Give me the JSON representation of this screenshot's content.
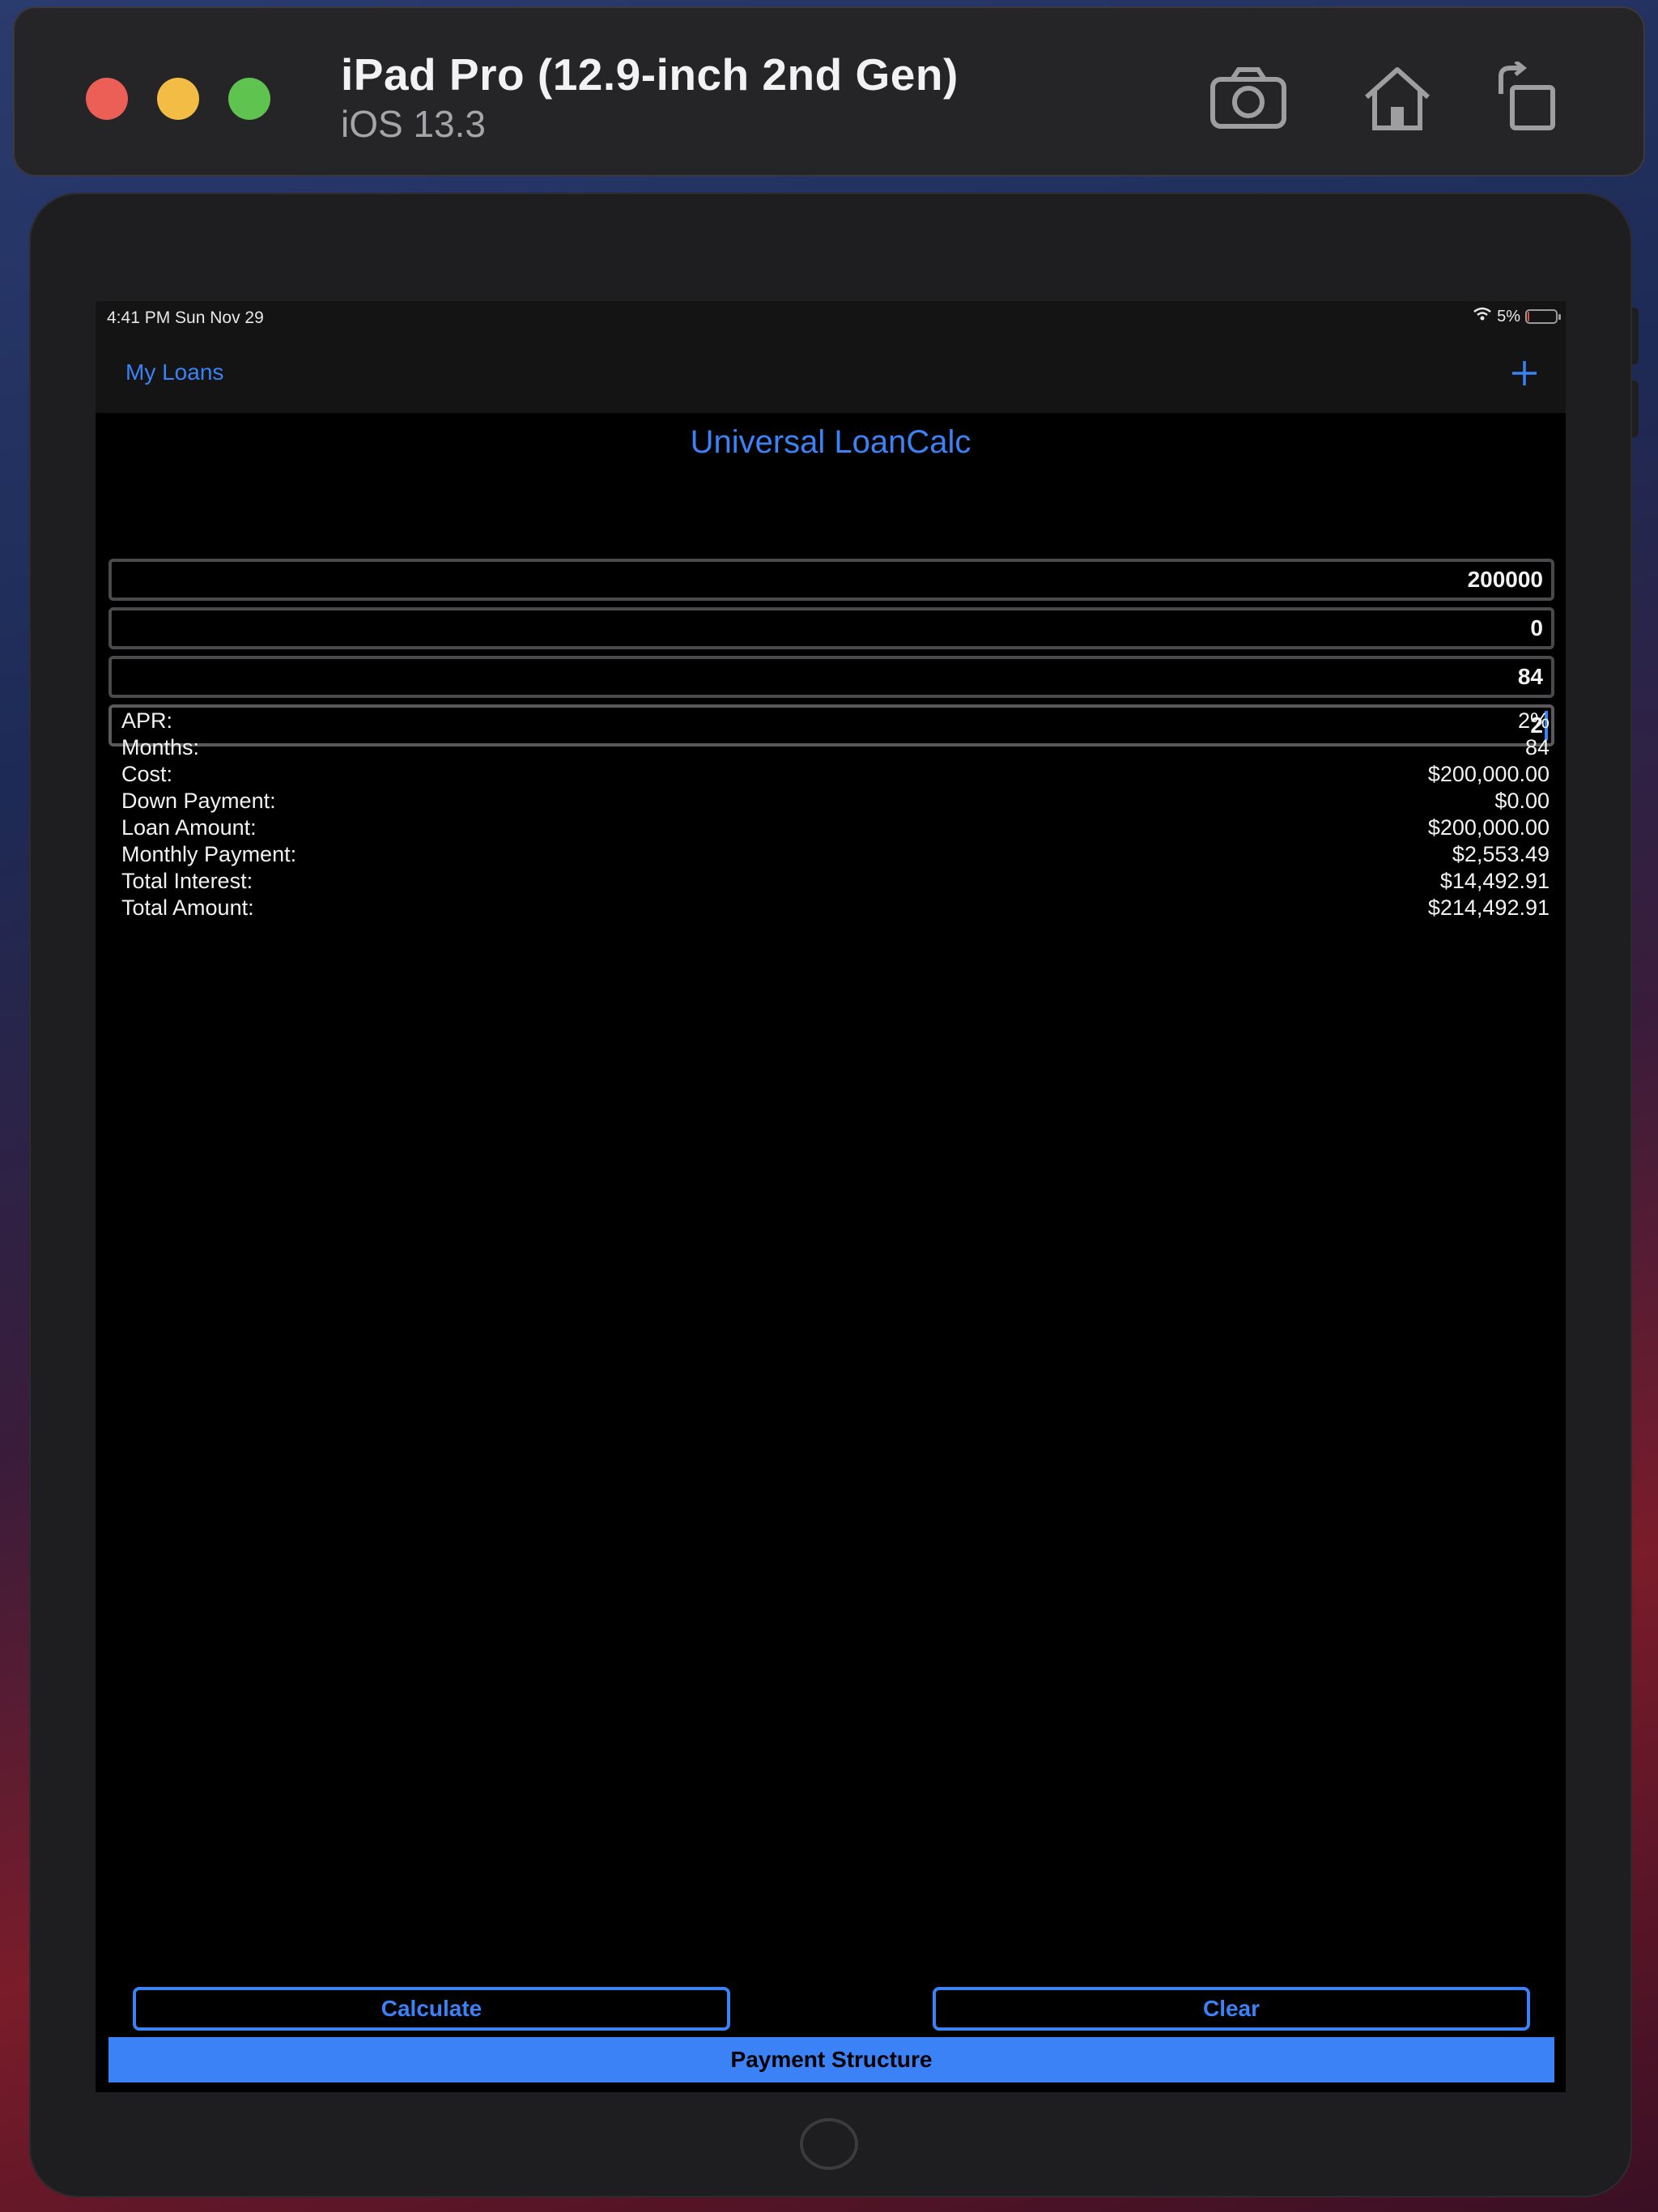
{
  "simulator": {
    "device_name": "iPad Pro (12.9-inch 2nd Gen)",
    "os_version": "iOS 13.3",
    "toolbar_icons": [
      "camera-icon",
      "home-icon",
      "rotate-icon"
    ]
  },
  "status_bar": {
    "time": "4:41 PM   Sun Nov 29",
    "battery": "5%",
    "battery_level": 0.05
  },
  "nav": {
    "back_label": "My Loans",
    "add_icon": "plus-icon"
  },
  "app_title": "Universal LoanCalc",
  "fields": {
    "cost": "200000",
    "down_payment": "0",
    "months": "84",
    "apr": "2"
  },
  "results": [
    {
      "label": "APR:",
      "value": "2%"
    },
    {
      "label": "Months:",
      "value": "84"
    },
    {
      "label": "Cost:",
      "value": "$200,000.00"
    },
    {
      "label": "Down Payment:",
      "value": "$0.00"
    },
    {
      "label": "Loan Amount:",
      "value": "$200,000.00"
    },
    {
      "label": "Monthly Payment:",
      "value": "$2,553.49"
    },
    {
      "label": "Total Interest:",
      "value": "$14,492.91"
    },
    {
      "label": "Total Amount:",
      "value": "$214,492.91"
    }
  ],
  "buttons": {
    "calculate": "Calculate",
    "clear": "Clear",
    "payment_structure": "Payment Structure"
  },
  "colors": {
    "accent": "#3b82f6",
    "background": "#000000",
    "bar": "#141414"
  }
}
